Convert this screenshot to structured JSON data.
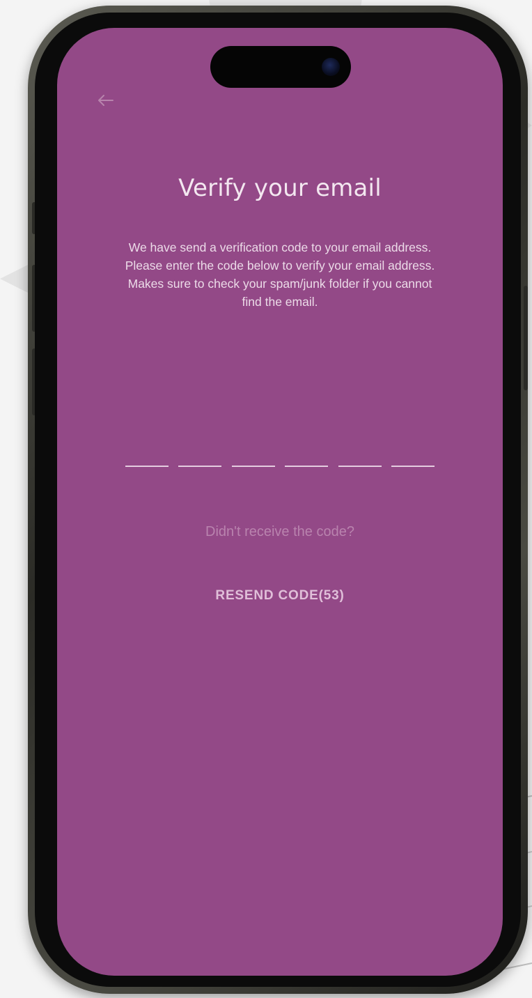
{
  "colors": {
    "screen_background": "#934987",
    "title_text": "#f3e7f0",
    "body_text": "#ecdbe8",
    "muted_text": "#b983ae",
    "resend_text": "#e0bfd9",
    "code_underline": "#e4cde0"
  },
  "header": {
    "back_icon": "arrow-left-icon"
  },
  "verify": {
    "title": "Verify your email",
    "description": "We have send a verification code to your email address. Please enter the code below to verify your email address. Makes sure to check your spam/junk folder if you cannot find the email.",
    "code_digits": [
      "",
      "",
      "",
      "",
      "",
      ""
    ],
    "no_code_text": "Didn't receive the code?",
    "resend_label": "RESEND CODE(53)"
  }
}
